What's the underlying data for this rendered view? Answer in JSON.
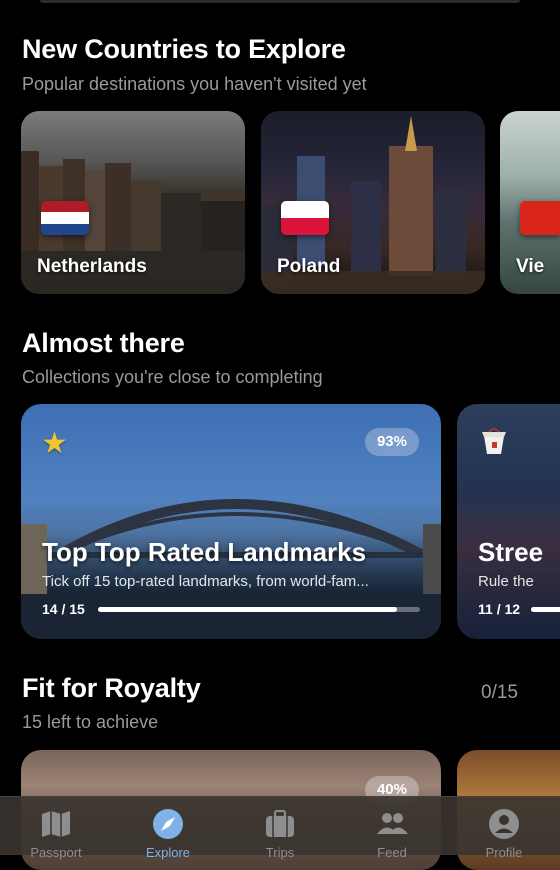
{
  "new_countries": {
    "title": "New Countries to Explore",
    "subtitle": "Popular destinations you haven't visited yet",
    "cards": [
      {
        "name": "Netherlands",
        "flag": [
          "#ae1c28",
          "#ffffff",
          "#21468b"
        ]
      },
      {
        "name": "Poland",
        "flag": [
          "#ffffff",
          "#dc143c"
        ]
      },
      {
        "name": "Vie",
        "flag": [
          "#da251d"
        ]
      }
    ]
  },
  "almost_there": {
    "title": "Almost there",
    "subtitle": "Collections you're close to completing",
    "main_card": {
      "badge": "93%",
      "title": "Top Top Rated Landmarks",
      "description": "Tick off 15 top-rated landmarks, from world-fam...",
      "count": "14 / 15",
      "progress": 0.93,
      "icon": "star-icon"
    },
    "side_card": {
      "title": "Stree",
      "description": "Rule the",
      "count": "11 / 12",
      "icon": "takeout-box-icon"
    }
  },
  "royalty": {
    "title": "Fit for Royalty",
    "subtitle": "15 left to achieve",
    "count": "0/15",
    "card_badge": "40%"
  },
  "tabbar": {
    "items": [
      {
        "label": "Passport",
        "icon": "map-icon",
        "active": false
      },
      {
        "label": "Explore",
        "icon": "compass-icon",
        "active": true
      },
      {
        "label": "Trips",
        "icon": "suitcase-icon",
        "active": false
      },
      {
        "label": "Feed",
        "icon": "people-icon",
        "active": false
      },
      {
        "label": "Profile",
        "icon": "person-circle-icon",
        "active": false
      }
    ]
  },
  "colors": {
    "background": "#000000",
    "accent": "#7fb3e6",
    "muted": "#9a9a9a"
  }
}
